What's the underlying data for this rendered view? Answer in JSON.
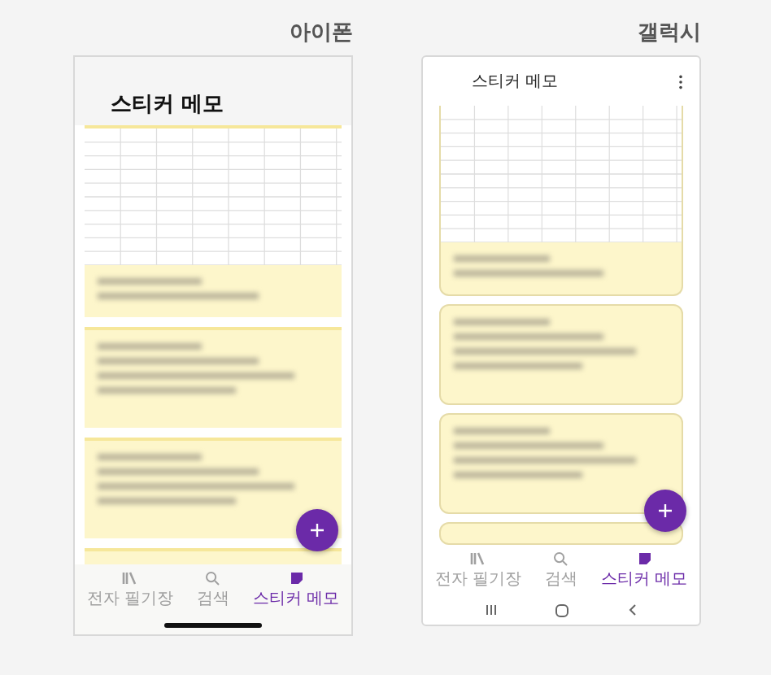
{
  "phones": [
    {
      "kind": "iphone",
      "label": "아이폰",
      "title": "스티커 메모",
      "menu": false,
      "cards": [
        {
          "kind": "table"
        },
        {
          "kind": "text"
        },
        {
          "kind": "text"
        },
        {
          "kind": "partial"
        }
      ],
      "nav": [
        {
          "kind": "books",
          "label": "전자 필기장",
          "selected": false
        },
        {
          "kind": "search",
          "label": "검색",
          "selected": false
        },
        {
          "kind": "note",
          "label": "스티커 메모",
          "selected": true
        }
      ]
    },
    {
      "kind": "galaxy",
      "label": "갤럭시",
      "title": "스티커 메모",
      "menu": true,
      "cards": [
        {
          "kind": "table"
        },
        {
          "kind": "text"
        },
        {
          "kind": "text"
        },
        {
          "kind": "partial"
        }
      ],
      "nav": [
        {
          "kind": "books",
          "label": "전자 필기장",
          "selected": false
        },
        {
          "kind": "search",
          "label": "검색",
          "selected": false
        },
        {
          "kind": "note",
          "label": "스티커 메모",
          "selected": true
        }
      ],
      "system_nav": [
        {
          "kind": "recents"
        },
        {
          "kind": "home"
        },
        {
          "kind": "back"
        }
      ]
    }
  ]
}
